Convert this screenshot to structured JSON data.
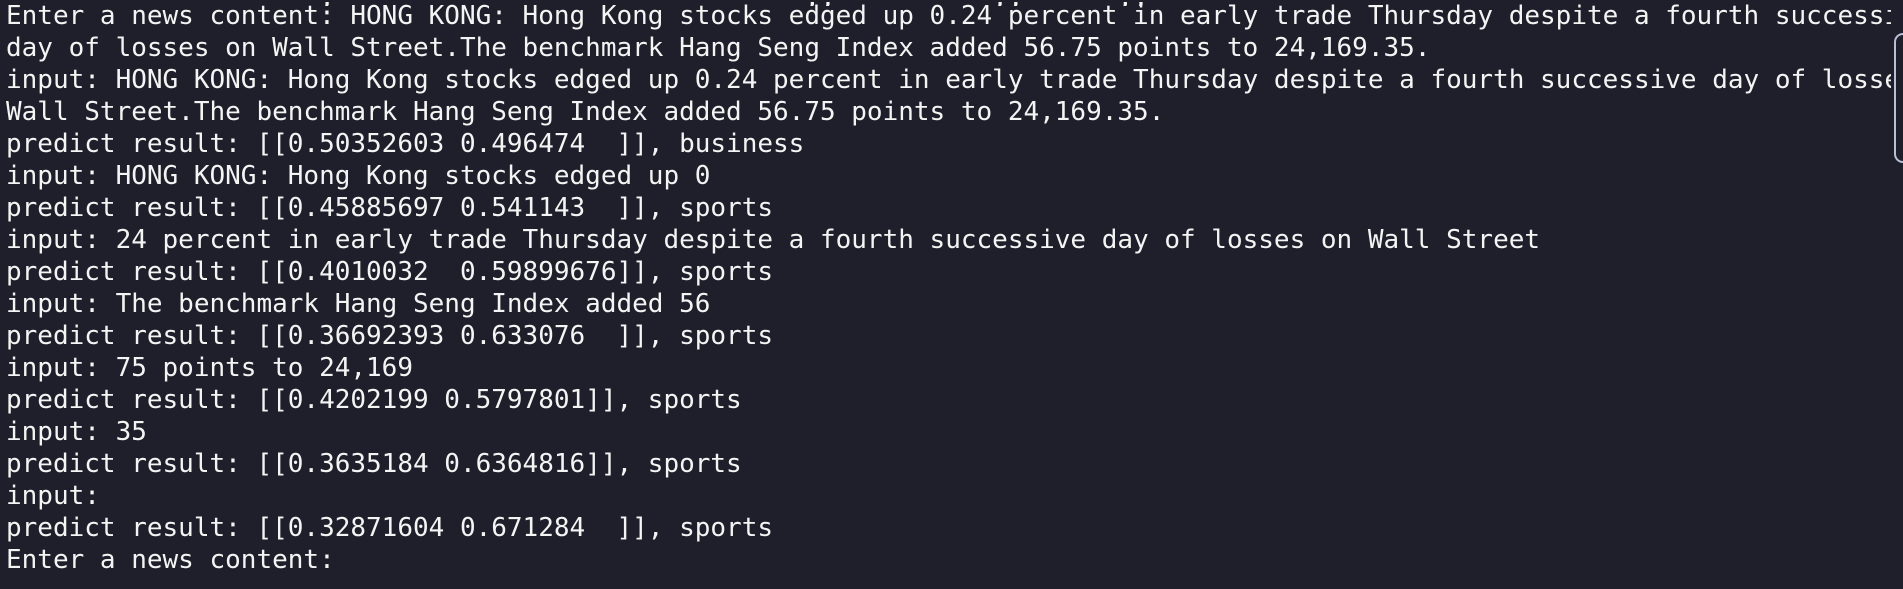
{
  "terminal": {
    "cropped_line": "                    ,                              ,,          ,,      ,,",
    "lines": [
      "Enter a news content: HONG KONG: Hong Kong stocks edged up 0.24 percent in early trade Thursday despite a fourth successive",
      "day of losses on Wall Street.The benchmark Hang Seng Index added 56.75 points to 24,169.35.",
      "input: HONG KONG: Hong Kong stocks edged up 0.24 percent in early trade Thursday despite a fourth successive day of losses on",
      "Wall Street.The benchmark Hang Seng Index added 56.75 points to 24,169.35.",
      "predict result: [[0.50352603 0.496474  ]], business",
      "input: HONG KONG: Hong Kong stocks edged up 0",
      "predict result: [[0.45885697 0.541143  ]], sports",
      "input: 24 percent in early trade Thursday despite a fourth successive day of losses on Wall Street",
      "predict result: [[0.4010032  0.59899676]], sports",
      "input: The benchmark Hang Seng Index added 56",
      "predict result: [[0.36692393 0.633076  ]], sports",
      "input: 75 points to 24,169",
      "predict result: [[0.4202199 0.5797801]], sports",
      "input: 35",
      "predict result: [[0.3635184 0.6364816]], sports",
      "input: ",
      "predict result: [[0.32871604 0.671284  ]], sports",
      "Enter a news content: "
    ]
  },
  "colors": {
    "background": "#1e1f2a",
    "text": "#f4f4f4",
    "scrollbar": "#b9bfd6"
  }
}
